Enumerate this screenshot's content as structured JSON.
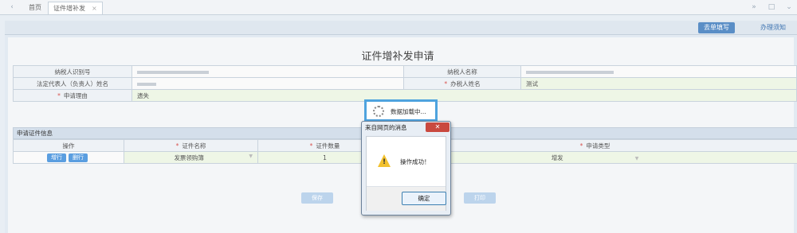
{
  "tabbar": {
    "left_arrow": "‹",
    "home_tab": "首页",
    "active_tab": "证件增补发",
    "tab_close": "×",
    "right_arrow": "»",
    "restore": "□",
    "more": "⌄"
  },
  "toolbar": {
    "fill_button": "去单填写",
    "notice_button": "办理须知"
  },
  "form": {
    "title": "证件增补发申请",
    "taxpayer_id_label": "纳税人识别号",
    "taxpayer_name_label": "纳税人名称",
    "legal_rep_label": "法定代表人（负责人）姓名",
    "handler_label": "办税人姓名",
    "handler_value": "测试",
    "reason_label": "申请理由",
    "reason_value": "遗失",
    "required_mark": "*"
  },
  "section": {
    "title": "申请证件信息",
    "headers": [
      "操作",
      "证件名称",
      "证件数量",
      "申请类型"
    ],
    "row": {
      "add_button": "增行",
      "delete_button": "删行",
      "cert_name": "发票领购簿",
      "quantity": "1",
      "apply_type": "增发"
    }
  },
  "bottom_buttons": {
    "save": "保存",
    "print": "打印"
  },
  "loading": {
    "text": "数据加载中..."
  },
  "dialog": {
    "title": "来自网页的消息",
    "close": "✕",
    "message": "操作成功！",
    "ok": "确定"
  },
  "colors": {
    "accent": "#5a8ec6",
    "dialog_border": "#4fa3de",
    "close_red": "#c9493f",
    "warning_yellow": "#f2c12e"
  }
}
